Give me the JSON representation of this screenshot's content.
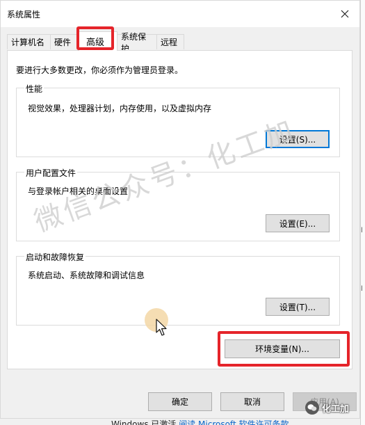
{
  "window": {
    "title": "系统属性",
    "close_icon": "close-icon"
  },
  "tabs": [
    {
      "label": "计算机名",
      "active": false
    },
    {
      "label": "硬件",
      "active": false
    },
    {
      "label": "高级",
      "active": true
    },
    {
      "label": "系统保护",
      "active": false
    },
    {
      "label": "远程",
      "active": false
    }
  ],
  "advanced": {
    "admin_note": "要进行大多数更改，你必须作为管理员登录。",
    "performance": {
      "title": "性能",
      "description": "视觉效果，处理器计划，内存使用，以及虚拟内存",
      "button": "设置(S)..."
    },
    "user_profiles": {
      "title": "用户配置文件",
      "description": "与登录帐户相关的桌面设置",
      "button": "设置(E)..."
    },
    "startup_recovery": {
      "title": "启动和故障恢复",
      "description": "系统启动、系统故障和调试信息",
      "button": "设置(T)..."
    },
    "env_button": "环境变量(N)..."
  },
  "footer": {
    "ok": "确定",
    "cancel": "取消",
    "apply": "应用(A)"
  },
  "watermark": "微信公众号：化工加",
  "taskbar": {
    "text": "Windows 已激活",
    "link": "阅读 Microsoft 软件许可条款"
  },
  "brand": {
    "text": "化工加"
  },
  "colors": {
    "highlight": "#e5242a",
    "focus_border": "#0078d7"
  }
}
